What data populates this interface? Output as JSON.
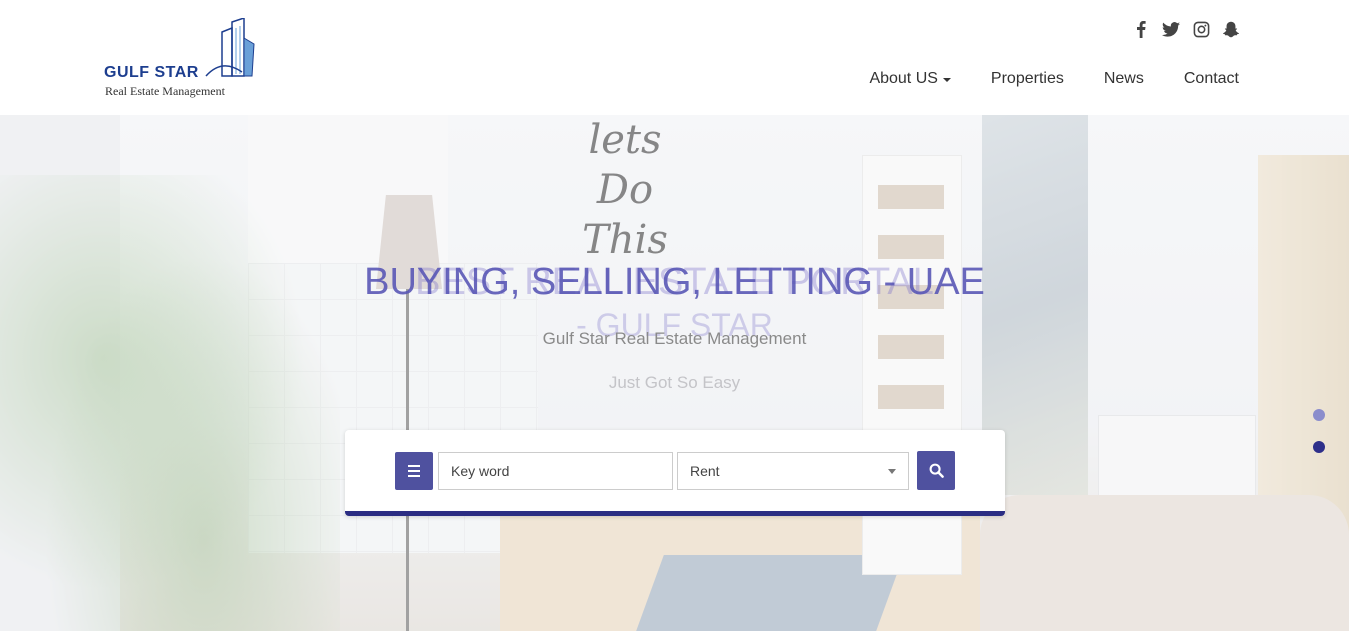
{
  "brand": {
    "name": "GULF STAR",
    "tagline": "Real Estate Management"
  },
  "social": [
    {
      "icon": "facebook-icon",
      "glyph": "f"
    },
    {
      "icon": "twitter-icon"
    },
    {
      "icon": "instagram-icon"
    },
    {
      "icon": "snapchat-icon"
    }
  ],
  "nav": {
    "about": "About US",
    "properties": "Properties",
    "news": "News",
    "contact": "Contact"
  },
  "hero": {
    "background_lettering": "lets Do This",
    "title": "BUYING, SELLING, LETTING - UAE",
    "title_ghost": "BEST REAL ESTATE PORTAL",
    "subtitle_ghost": "- GULF STAR",
    "subtitle": "Gulf Star Real Estate Management",
    "tagline": "Just Got So Easy"
  },
  "search": {
    "keyword_placeholder": "Key word",
    "type_selected": "Rent"
  },
  "slider": {
    "slide_count": 2,
    "active_index": 1
  },
  "colors": {
    "accent": "#4f519f",
    "accent_dark": "#2b2d83",
    "title": "#5a58b6"
  }
}
